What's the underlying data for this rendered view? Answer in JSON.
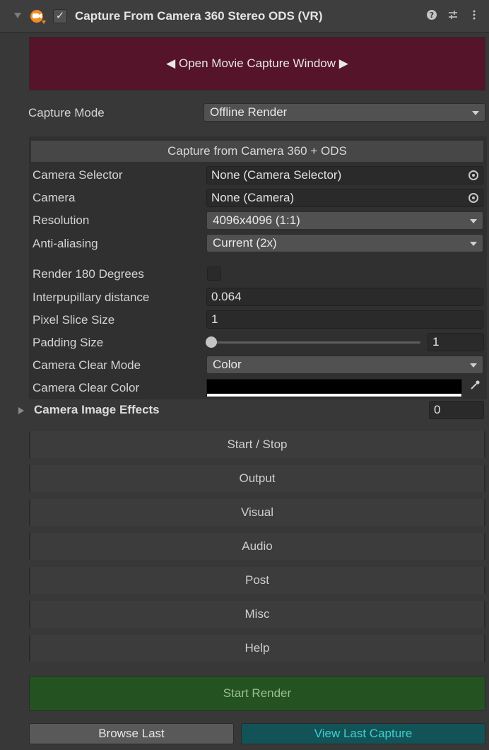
{
  "header": {
    "title": "Capture From Camera 360 Stereo ODS (VR)",
    "enabled": true,
    "icons": [
      "foldout-triangle-icon",
      "movie-capture-logo-icon",
      "help-icon",
      "preset-icon",
      "menu-dots-icon"
    ]
  },
  "open_window_button": "◀ Open Movie Capture Window ▶",
  "capture_mode": {
    "label": "Capture Mode",
    "value": "Offline Render"
  },
  "camera_group": {
    "heading": "Capture from Camera 360 + ODS",
    "camera_selector": {
      "label": "Camera Selector",
      "value": "None (Camera Selector)"
    },
    "camera": {
      "label": "Camera",
      "value": "None (Camera)"
    },
    "resolution": {
      "label": "Resolution",
      "value": "4096x4096 (1:1)"
    },
    "anti_aliasing": {
      "label": "Anti-aliasing",
      "value": "Current (2x)"
    },
    "render_180": {
      "label": "Render 180 Degrees",
      "checked": false
    },
    "ipd": {
      "label": "Interpupillary distance",
      "value": "0.064"
    },
    "pixel_slice": {
      "label": "Pixel Slice Size",
      "value": "1"
    },
    "padding": {
      "label": "Padding Size",
      "value": "1",
      "slider_fraction": 0
    },
    "clear_mode": {
      "label": "Camera Clear Mode",
      "value": "Color"
    },
    "clear_color": {
      "label": "Camera Clear Color",
      "color": "#000000",
      "alpha_color": "#ffffff"
    }
  },
  "image_effects": {
    "label": "Camera Image Effects",
    "count": "0"
  },
  "sections": [
    "Start / Stop",
    "Output",
    "Visual",
    "Audio",
    "Post",
    "Misc",
    "Help"
  ],
  "start_render": "Start Render",
  "browse_last": "Browse Last",
  "view_last_capture": "View Last Capture",
  "colors": {
    "open_window_bg": "#551429",
    "start_render_bg": "#245221",
    "view_last_bg": "#125357",
    "view_last_text": "#3fcfcf"
  }
}
